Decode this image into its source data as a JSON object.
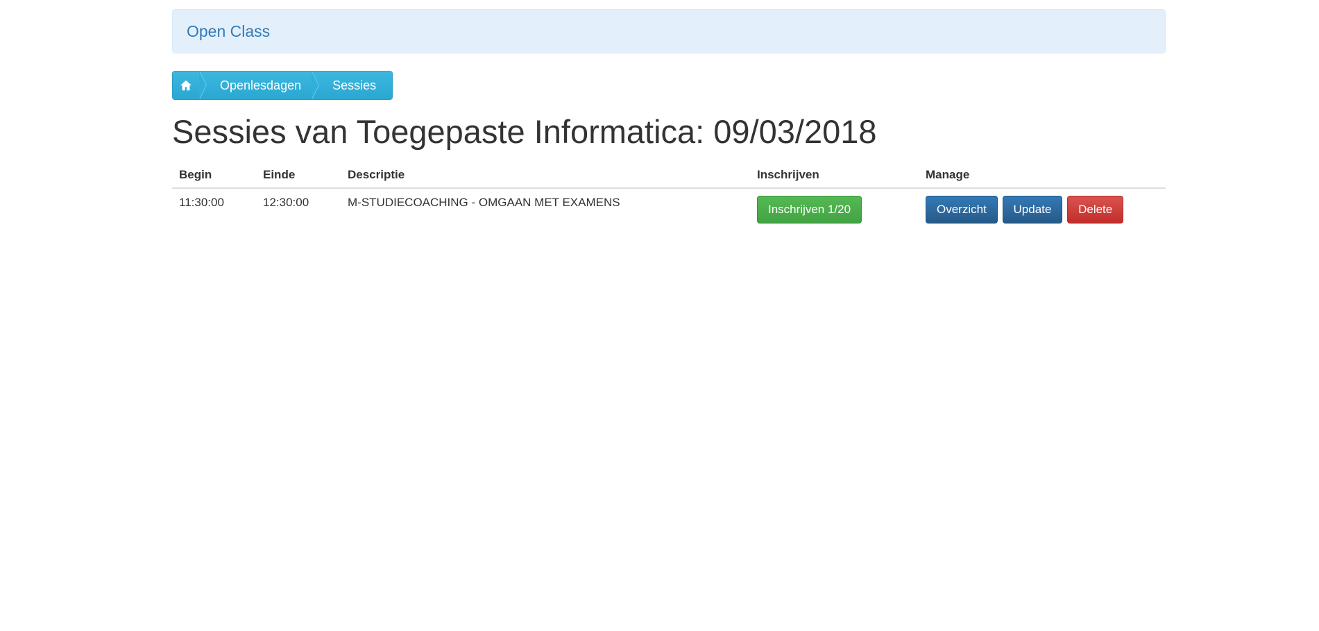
{
  "brand": {
    "title": "Open Class"
  },
  "breadcrumb": {
    "home_icon": "home-icon",
    "items": [
      "Openlesdagen",
      "Sessies"
    ]
  },
  "page": {
    "title": "Sessies van Toegepaste Informatica: 09/03/2018"
  },
  "table": {
    "headers": [
      "Begin",
      "Einde",
      "Descriptie",
      "Inschrijven",
      "Manage"
    ],
    "rows": [
      {
        "begin": "11:30:00",
        "einde": "12:30:00",
        "descriptie": "M-STUDIECOACHING - OMGAAN MET EXAMENS",
        "inschrijven": "Inschrijven 1/20",
        "actions": {
          "overzicht": "Overzicht",
          "update": "Update",
          "delete": "Delete"
        }
      }
    ]
  },
  "colors": {
    "success": "#45a844",
    "primary": "#2c6aa1",
    "danger": "#d0403c",
    "crumb": "#34b3dc",
    "brand_bg": "#e3f0fb",
    "brand_text": "#337ab7"
  }
}
